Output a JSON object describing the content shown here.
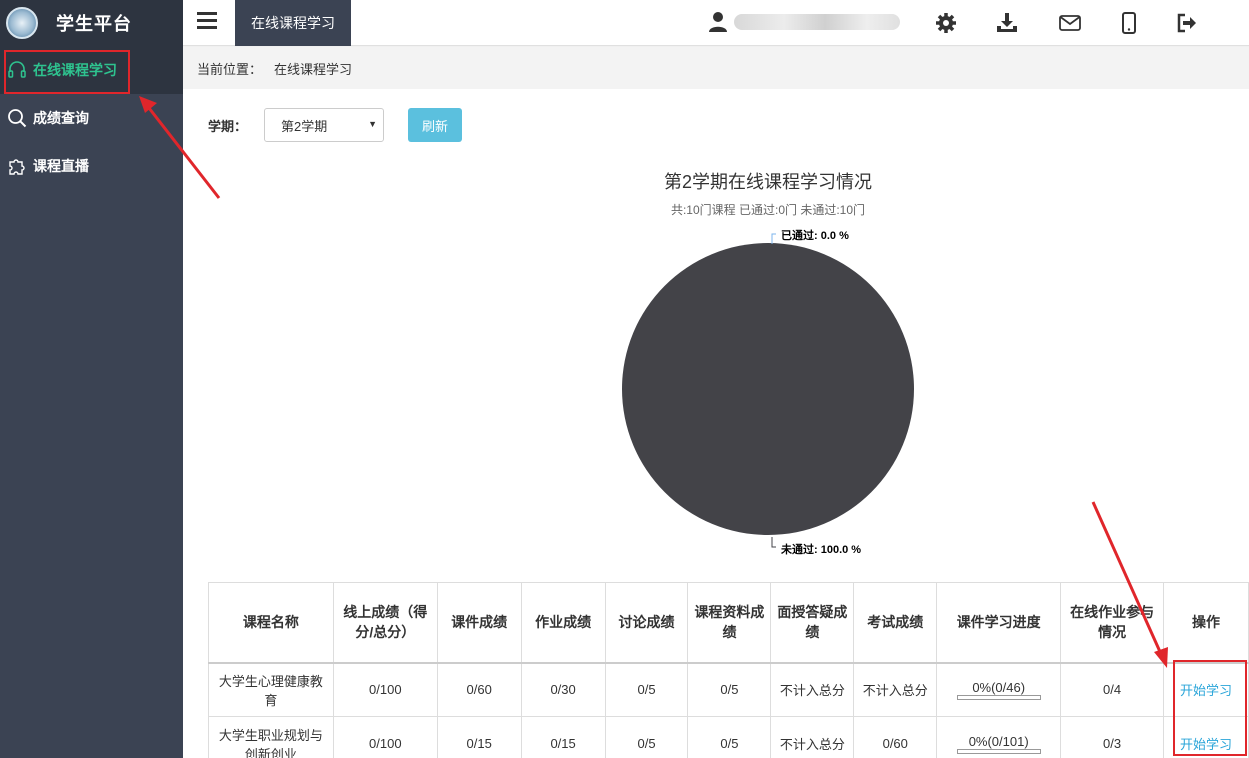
{
  "brand": {
    "title": "学生平台"
  },
  "sidebar": {
    "items": [
      {
        "label": "在线课程学习",
        "icon": "headphones-icon",
        "active": true
      },
      {
        "label": "成绩查询",
        "icon": "search-icon",
        "active": false
      },
      {
        "label": "课程直播",
        "icon": "puzzle-icon",
        "active": false
      }
    ]
  },
  "topbar": {
    "tab_label": "在线课程学习",
    "icons": [
      "user-icon",
      "gear-icon",
      "download-icon",
      "mail-icon",
      "mobile-icon",
      "logout-icon"
    ]
  },
  "breadcrumb": {
    "prefix": "当前位置：",
    "current": "在线课程学习"
  },
  "filter": {
    "label": "学期：",
    "semester_value": "第2学期",
    "refresh_label": "刷新"
  },
  "chart_title": "第2学期在线课程学习情况",
  "chart_subtitle": "共:10门课程 已通过:0门 未通过:10门",
  "chart_data": {
    "type": "pie",
    "title": "第2学期在线课程学习情况",
    "subtitle": "共:10门课程 已通过:0门 未通过:10门",
    "slices": [
      {
        "label": "已通过",
        "value": 0.0,
        "display": "已通过: 0.0 %",
        "color": "#7cb5ec"
      },
      {
        "label": "未通过",
        "value": 100.0,
        "display": "未通过: 100.0 %",
        "color": "#434348"
      }
    ]
  },
  "table": {
    "headers": [
      "课程名称",
      "线上成绩（得分/总分）",
      "课件成绩",
      "作业成绩",
      "讨论成绩",
      "课程资料成绩",
      "面授答疑成绩",
      "考试成绩",
      "课件学习进度",
      "在线作业参与情况",
      "操作"
    ],
    "rows": [
      {
        "name": "大学生心理健康教育",
        "online": "0/100",
        "courseware": "0/60",
        "homework": "0/30",
        "discussion": "0/5",
        "materials": "0/5",
        "faceqa": "不计入总分",
        "exam": "不计入总分",
        "progress_text": "0%(0/46)",
        "progress": 0,
        "hw_participation": "0/4",
        "action": "开始学习"
      },
      {
        "name": "大学生职业规划与创新创业",
        "online": "0/100",
        "courseware": "0/15",
        "homework": "0/15",
        "discussion": "0/5",
        "materials": "0/5",
        "faceqa": "不计入总分",
        "exam": "0/60",
        "progress_text": "0%(0/101)",
        "progress": 0,
        "hw_participation": "0/3",
        "action": "开始学习"
      }
    ]
  }
}
